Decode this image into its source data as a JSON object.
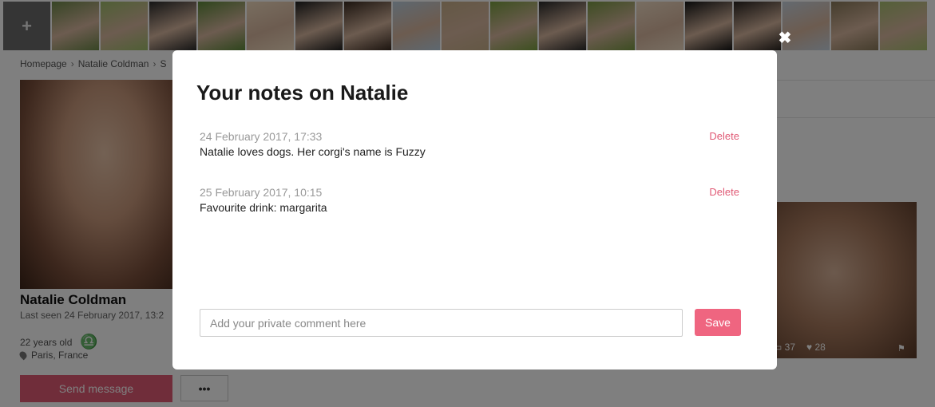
{
  "thumbnails": {
    "add_symbol": "+",
    "colors": [
      "#6e8a4a",
      "#9fbe6a",
      "#2b2b2b",
      "#5e8a3a",
      "#f2dcc0",
      "#1f1f1f",
      "#3a2a20",
      "#bcd0e0",
      "#c8b08a",
      "#7aa040",
      "#2a2a2a",
      "#7a9a44",
      "#f0dcc4",
      "#151515",
      "#2a2420",
      "#c8d4e0",
      "#8a7a5a",
      "#a8c070"
    ]
  },
  "breadcrumb": {
    "items": [
      "Homepage",
      "Natalie Coldman",
      "S"
    ],
    "separator": "›"
  },
  "profile": {
    "name": "Natalie Coldman",
    "last_seen": "Last seen 24 February 2017, 13:2",
    "age": "22 years old",
    "zodiac_symbol": "♎",
    "location": "Paris, France",
    "send_message_label": "Send message",
    "more_label": "•••"
  },
  "side_photo": {
    "views": "37",
    "likes": "28"
  },
  "modal": {
    "close_symbol": "✖",
    "title": "Your notes on Natalie",
    "notes": [
      {
        "date": "24 February 2017, 17:33",
        "text": "Natalie loves dogs. Her corgi's name is Fuzzy",
        "delete_label": "Delete"
      },
      {
        "date": "25 February 2017, 10:15",
        "text": "Favourite drink: margarita",
        "delete_label": "Delete"
      }
    ],
    "comment_placeholder": "Add your private comment here",
    "comment_value": "",
    "save_label": "Save"
  },
  "colors": {
    "accent": "#ef6580",
    "delete_text": "#e05a75",
    "overlay": "rgba(0,0,0,0.5)"
  }
}
